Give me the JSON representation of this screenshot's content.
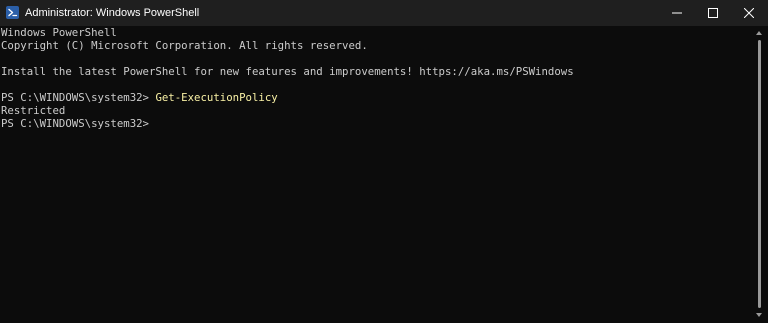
{
  "window": {
    "title": "Administrator: Windows PowerShell",
    "app_icon": "powershell-icon",
    "controls": {
      "minimize_icon": "minimize-icon",
      "maximize_icon": "maximize-icon",
      "close_icon": "close-icon"
    }
  },
  "console": {
    "lines": [
      "Windows PowerShell",
      "Copyright (C) Microsoft Corporation. All rights reserved.",
      "",
      "Install the latest PowerShell for new features and improvements! https://aka.ms/PSWindows",
      "",
      {
        "prompt": "PS C:\\WINDOWS\\system32> ",
        "command": "Get-ExecutionPolicy"
      },
      "Restricted",
      "PS C:\\WINDOWS\\system32>"
    ]
  },
  "colors": {
    "background": "#0c0c0c",
    "titlebar": "#1f1f1f",
    "text": "#cccccc",
    "command": "#f9f1a5",
    "icon_blue": "#2b5fa8"
  }
}
